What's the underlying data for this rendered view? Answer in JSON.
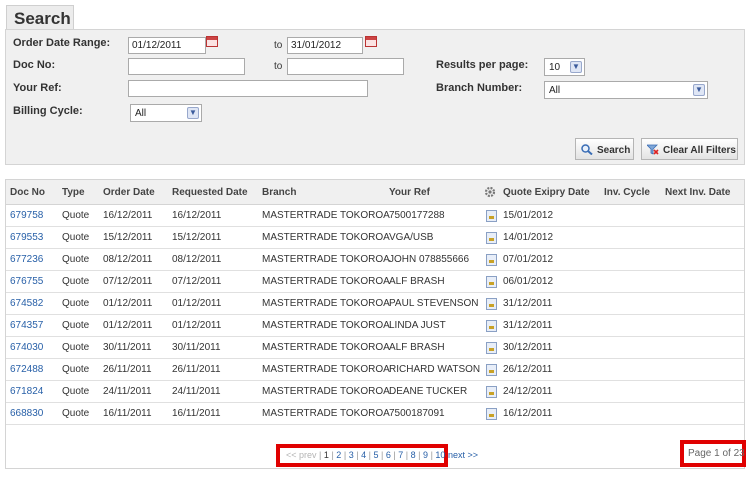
{
  "title": "Search",
  "filters": {
    "order_date_label": "Order Date Range:",
    "order_date_from": "01/12/2011",
    "to_label": "to",
    "order_date_to": "31/01/2012",
    "doc_no_label": "Doc No:",
    "doc_no_from": "",
    "doc_no_to": "",
    "your_ref_label": "Your Ref:",
    "your_ref_value": "",
    "billing_cycle_label": "Billing Cycle:",
    "billing_cycle_value": "All",
    "results_per_page_label": "Results per page:",
    "results_per_page_value": "10",
    "branch_number_label": "Branch Number:",
    "branch_number_value": "All",
    "search_button": "Search",
    "clear_button": "Clear All Filters"
  },
  "table": {
    "columns": [
      "Doc No",
      "Type",
      "Order Date",
      "Requested Date",
      "Branch",
      "Your Ref",
      "Quote Exipry Date",
      "Inv. Cycle",
      "Next Inv. Date"
    ],
    "rows": [
      [
        "679758",
        "Quote",
        "16/12/2011",
        "16/12/2011",
        "MASTERTRADE TOKOROA",
        "7500177288",
        "15/01/2012"
      ],
      [
        "679553",
        "Quote",
        "15/12/2011",
        "15/12/2011",
        "MASTERTRADE TOKOROA",
        "VGA/USB",
        "14/01/2012"
      ],
      [
        "677236",
        "Quote",
        "08/12/2011",
        "08/12/2011",
        "MASTERTRADE TOKOROA",
        "JOHN 078855666",
        "07/01/2012"
      ],
      [
        "676755",
        "Quote",
        "07/12/2011",
        "07/12/2011",
        "MASTERTRADE TOKOROA",
        "ALF BRASH",
        "06/01/2012"
      ],
      [
        "674582",
        "Quote",
        "01/12/2011",
        "01/12/2011",
        "MASTERTRADE TOKOROA",
        "PAUL STEVENSON",
        "31/12/2011"
      ],
      [
        "674357",
        "Quote",
        "01/12/2011",
        "01/12/2011",
        "MASTERTRADE TOKOROA",
        "LINDA JUST",
        "31/12/2011"
      ],
      [
        "674030",
        "Quote",
        "30/11/2011",
        "30/11/2011",
        "MASTERTRADE TOKOROA",
        "ALF BRASH",
        "30/12/2011"
      ],
      [
        "672488",
        "Quote",
        "26/11/2011",
        "26/11/2011",
        "MASTERTRADE TOKOROA",
        "RICHARD WATSON",
        "26/12/2011"
      ],
      [
        "671824",
        "Quote",
        "24/11/2011",
        "24/11/2011",
        "MASTERTRADE TOKOROA",
        "DEANE TUCKER",
        "24/12/2011"
      ],
      [
        "668830",
        "Quote",
        "16/11/2011",
        "16/11/2011",
        "MASTERTRADE TOKOROA",
        "7500187091",
        "16/12/2011"
      ]
    ]
  },
  "pagination": {
    "prev": "<< prev",
    "pages": [
      "1",
      "2",
      "3",
      "4",
      "5",
      "6",
      "7",
      "8",
      "9",
      "10"
    ],
    "next": "next >>",
    "page_info": "Page 1 of 23"
  },
  "icons": {
    "calendar": "calendar-icon",
    "settings": "gear-icon",
    "quote": "quote-document-icon",
    "search": "magnifier-icon",
    "clear": "clear-filter-icon"
  }
}
